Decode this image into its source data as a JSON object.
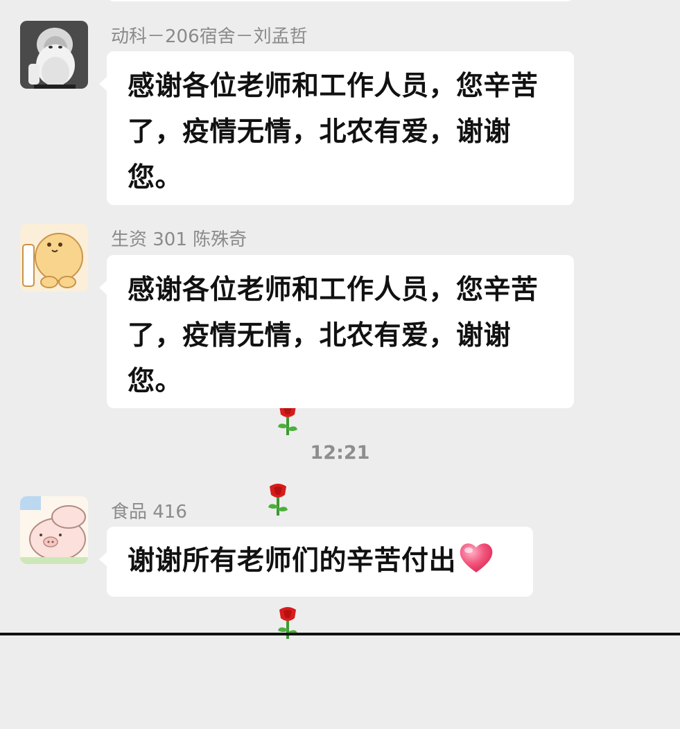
{
  "chat": {
    "messages": [
      {
        "sender": "动科－206宿舍－刘孟哲",
        "line1": "感谢各位老师和工作人员，您辛苦",
        "line2": "了，疫情无情，北农有爱，谢谢您。",
        "emoji": [
          "rose",
          "rose"
        ],
        "avatar": "portrait-avatar"
      },
      {
        "sender": "生资 301 陈殊奇",
        "line1": "感谢各位老师和工作人员，您辛苦",
        "line2": "了，疫情无情，北农有爱，谢谢您。",
        "emoji": [
          "rose",
          "rose"
        ],
        "avatar": "cartoon-chick-avatar"
      },
      {
        "sender": "食品 416",
        "line1": "谢谢所有老师们的辛苦付出",
        "emoji": [
          "heart"
        ],
        "avatar": "cartoon-pig-avatar"
      }
    ],
    "timestamp": "12:21"
  },
  "colors": {
    "background": "#ededed",
    "bubble": "#ffffff",
    "sender_text": "#8a8a8a",
    "message_text": "#111111",
    "timestamp_text": "#8e8e8e"
  }
}
